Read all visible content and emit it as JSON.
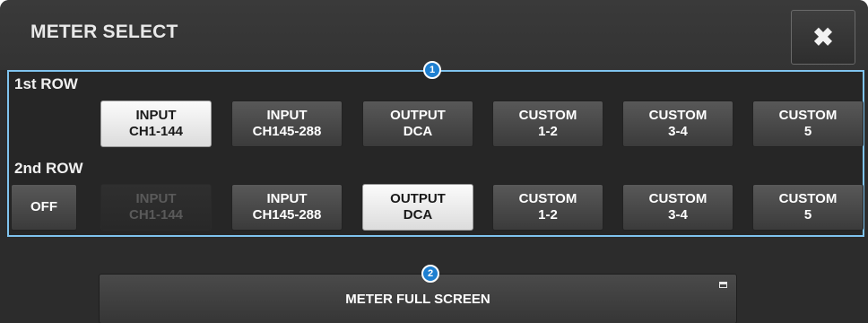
{
  "window": {
    "title": "METER SELECT",
    "close_icon_glyph": "✖"
  },
  "badges": {
    "rows_marker": "1",
    "fullscreen_marker": "2"
  },
  "row1": {
    "label": "1st ROW",
    "buttons": [
      {
        "line1": "INPUT",
        "line2": "CH1-144",
        "state": "selected"
      },
      {
        "line1": "INPUT",
        "line2": "CH145-288",
        "state": "normal"
      },
      {
        "line1": "OUTPUT",
        "line2": "DCA",
        "state": "normal"
      },
      {
        "line1": "CUSTOM",
        "line2": "1-2",
        "state": "normal"
      },
      {
        "line1": "CUSTOM",
        "line2": "3-4",
        "state": "normal"
      },
      {
        "line1": "CUSTOM",
        "line2": "5",
        "state": "normal"
      }
    ]
  },
  "row2": {
    "label": "2nd ROW",
    "off_label": "OFF",
    "buttons": [
      {
        "line1": "INPUT",
        "line2": "CH1-144",
        "state": "disabled"
      },
      {
        "line1": "INPUT",
        "line2": "CH145-288",
        "state": "normal"
      },
      {
        "line1": "OUTPUT",
        "line2": "DCA",
        "state": "selected"
      },
      {
        "line1": "CUSTOM",
        "line2": "1-2",
        "state": "normal"
      },
      {
        "line1": "CUSTOM",
        "line2": "3-4",
        "state": "normal"
      },
      {
        "line1": "CUSTOM",
        "line2": "5",
        "state": "normal"
      }
    ]
  },
  "fullscreen": {
    "label": "METER FULL SCREEN"
  }
}
